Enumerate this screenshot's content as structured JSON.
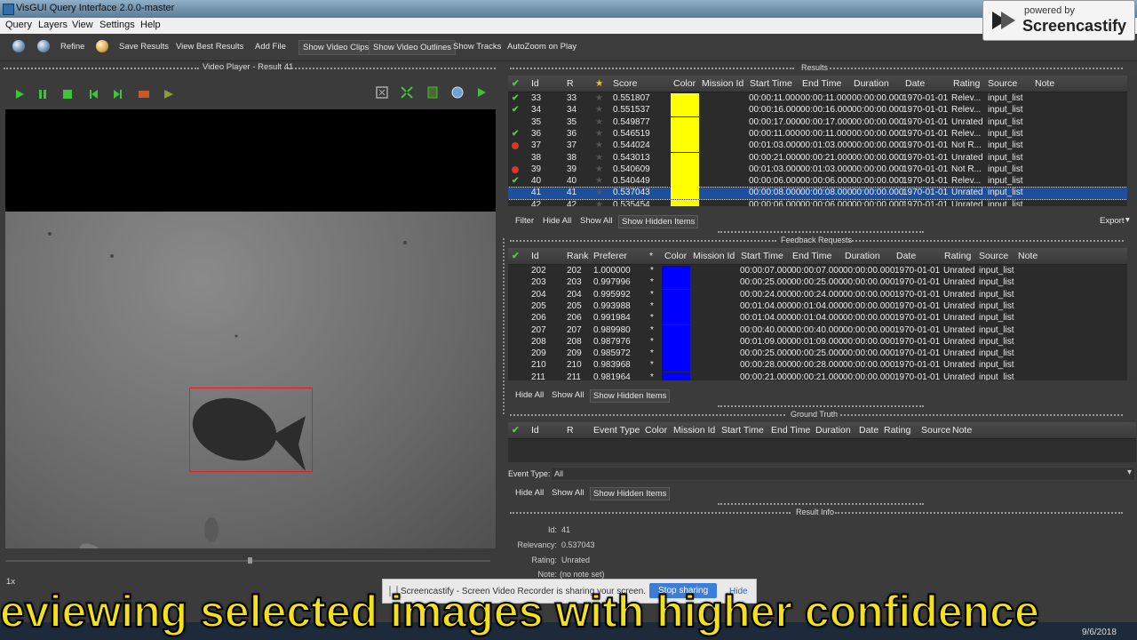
{
  "window": {
    "title": "VisGUI Query Interface 2.0.0-master"
  },
  "menu": [
    "Query",
    "Layers",
    "View",
    "Settings",
    "Help"
  ],
  "toolbar": {
    "refine": "Refine",
    "save_results": "Save Results",
    "view_best_results": "View Best Results",
    "add_file": "Add File",
    "show_video_clips": "Show Video Clips",
    "show_video_outlines": "Show Video Outlines",
    "show_tracks": "Show Tracks",
    "autozoom": "AutoZoom on Play"
  },
  "watermark": {
    "powered_by": "powered by",
    "brand": "Screencastify"
  },
  "video_player": {
    "title": "Video Player - Result 41",
    "speed": "1x"
  },
  "results": {
    "title": "Results",
    "columns": [
      "Id",
      "R",
      "★",
      "Score",
      "Color",
      "Mission Id",
      "Start Time",
      "End Time",
      "Duration",
      "Date",
      "Rating",
      "Source",
      "Note"
    ],
    "rows": [
      {
        "status": "check",
        "id": "33",
        "rank": "33",
        "score": "0.551807",
        "start": "00:00:11.000",
        "end": "00:00:11.000",
        "duration": "00:00:00.000",
        "date": "1970-01-01",
        "rating": "Relev...",
        "source": "input_list"
      },
      {
        "status": "check",
        "id": "34",
        "rank": "34",
        "score": "0.551537",
        "start": "00:00:16.000",
        "end": "00:00:16.000",
        "duration": "00:00:00.000",
        "date": "1970-01-01",
        "rating": "Relev...",
        "source": "input_list"
      },
      {
        "status": "",
        "id": "35",
        "rank": "35",
        "score": "0.549877",
        "start": "00:00:17.000",
        "end": "00:00:17.000",
        "duration": "00:00:00.000",
        "date": "1970-01-01",
        "rating": "Unrated",
        "source": "input_list"
      },
      {
        "status": "check",
        "id": "36",
        "rank": "36",
        "score": "0.546519",
        "start": "00:00:11.000",
        "end": "00:00:11.000",
        "duration": "00:00:00.000",
        "date": "1970-01-01",
        "rating": "Relev...",
        "source": "input_list"
      },
      {
        "status": "reject",
        "id": "37",
        "rank": "37",
        "score": "0.544024",
        "start": "00:01:03.000",
        "end": "00:01:03.000",
        "duration": "00:00:00.000",
        "date": "1970-01-01",
        "rating": "Not R...",
        "source": "input_list"
      },
      {
        "status": "",
        "id": "38",
        "rank": "38",
        "score": "0.543013",
        "start": "00:00:21.000",
        "end": "00:00:21.000",
        "duration": "00:00:00.000",
        "date": "1970-01-01",
        "rating": "Unrated",
        "source": "input_list"
      },
      {
        "status": "reject",
        "id": "39",
        "rank": "39",
        "score": "0.540609",
        "start": "00:01:03.000",
        "end": "00:01:03.000",
        "duration": "00:00:00.000",
        "date": "1970-01-01",
        "rating": "Not R...",
        "source": "input_list"
      },
      {
        "status": "check",
        "id": "40",
        "rank": "40",
        "score": "0.540449",
        "start": "00:00:06.000",
        "end": "00:00:06.000",
        "duration": "00:00:00.000",
        "date": "1970-01-01",
        "rating": "Relev...",
        "source": "input_list"
      },
      {
        "status": "",
        "id": "41",
        "rank": "41",
        "score": "0.537043",
        "start": "00:00:08.000",
        "end": "00:00:08.000",
        "duration": "00:00:00.000",
        "date": "1970-01-01",
        "rating": "Unrated",
        "source": "input_list",
        "selected": true
      },
      {
        "status": "",
        "id": "42",
        "rank": "42",
        "score": "0.535454",
        "start": "00:00:06.000",
        "end": "00:00:06.000",
        "duration": "00:00:00.000",
        "date": "1970-01-01",
        "rating": "Unrated",
        "source": "input_list"
      }
    ],
    "color": "#ffff00",
    "buttons": {
      "filter": "Filter",
      "hide_all": "Hide All",
      "show_all": "Show All",
      "show_hidden": "Show Hidden Items",
      "export": "Export"
    }
  },
  "feedback": {
    "title": "Feedback Requests",
    "columns": [
      "Id",
      "Rank",
      "Preferer",
      "*",
      "Color",
      "Mission Id",
      "Start Time",
      "End Time",
      "Duration",
      "Date",
      "Rating",
      "Source",
      "Note"
    ],
    "rows": [
      {
        "id": "202",
        "rank": "202",
        "pref": "1.000000",
        "start": "00:00:07.000",
        "end": "00:00:07.000",
        "duration": "00:00:00.000",
        "date": "1970-01-01",
        "rating": "Unrated",
        "source": "input_list"
      },
      {
        "id": "203",
        "rank": "203",
        "pref": "0.997996",
        "start": "00:00:25.000",
        "end": "00:00:25.000",
        "duration": "00:00:00.000",
        "date": "1970-01-01",
        "rating": "Unrated",
        "source": "input_list"
      },
      {
        "id": "204",
        "rank": "204",
        "pref": "0.995992",
        "start": "00:00:24.000",
        "end": "00:00:24.000",
        "duration": "00:00:00.000",
        "date": "1970-01-01",
        "rating": "Unrated",
        "source": "input_list"
      },
      {
        "id": "205",
        "rank": "205",
        "pref": "0.993988",
        "start": "00:01:04.000",
        "end": "00:01:04.000",
        "duration": "00:00:00.000",
        "date": "1970-01-01",
        "rating": "Unrated",
        "source": "input_list"
      },
      {
        "id": "206",
        "rank": "206",
        "pref": "0.991984",
        "start": "00:01:04.000",
        "end": "00:01:04.000",
        "duration": "00:00:00.000",
        "date": "1970-01-01",
        "rating": "Unrated",
        "source": "input_list"
      },
      {
        "id": "207",
        "rank": "207",
        "pref": "0.989980",
        "start": "00:00:40.000",
        "end": "00:00:40.000",
        "duration": "00:00:00.000",
        "date": "1970-01-01",
        "rating": "Unrated",
        "source": "input_list"
      },
      {
        "id": "208",
        "rank": "208",
        "pref": "0.987976",
        "start": "00:01:09.000",
        "end": "00:01:09.000",
        "duration": "00:00:00.000",
        "date": "1970-01-01",
        "rating": "Unrated",
        "source": "input_list"
      },
      {
        "id": "209",
        "rank": "209",
        "pref": "0.985972",
        "start": "00:00:25.000",
        "end": "00:00:25.000",
        "duration": "00:00:00.000",
        "date": "1970-01-01",
        "rating": "Unrated",
        "source": "input_list"
      },
      {
        "id": "210",
        "rank": "210",
        "pref": "0.983968",
        "start": "00:00:28.000",
        "end": "00:00:28.000",
        "duration": "00:00:00.000",
        "date": "1970-01-01",
        "rating": "Unrated",
        "source": "input_list"
      },
      {
        "id": "211",
        "rank": "211",
        "pref": "0.981964",
        "start": "00:00:21.000",
        "end": "00:00:21.000",
        "duration": "00:00:00.000",
        "date": "1970-01-01",
        "rating": "Unrated",
        "source": "input_list"
      }
    ],
    "color": "#0000ff",
    "buttons": {
      "hide_all": "Hide All",
      "show_all": "Show All",
      "show_hidden": "Show Hidden Items"
    }
  },
  "ground_truth": {
    "title": "Ground Truth",
    "columns": [
      "Id",
      "R",
      "Event Type",
      "Color",
      "Mission Id",
      "Start Time",
      "End Time",
      "Duration",
      "Date",
      "Rating",
      "Source",
      "Note"
    ],
    "event_type_label": "Event Type:",
    "event_type_value": "All",
    "buttons": {
      "hide_all": "Hide All",
      "show_all": "Show All",
      "show_hidden": "Show Hidden Items"
    }
  },
  "result_info": {
    "title": "Result Info",
    "id_label": "Id:",
    "id_value": "41",
    "relevancy_label": "Relevancy:",
    "relevancy_value": "0.537043",
    "rating_label": "Rating:",
    "rating_value": "Unrated",
    "note_label": "Note:",
    "note_value": "(no note set)"
  },
  "sharing_bar": {
    "text": "Screencastify - Screen Video Recorder is sharing your screen.",
    "stop": "Stop sharing",
    "hide": "Hide"
  },
  "clock": {
    "date": "9/6/2018"
  },
  "subtitle": "eviewing selected images with higher confidence"
}
